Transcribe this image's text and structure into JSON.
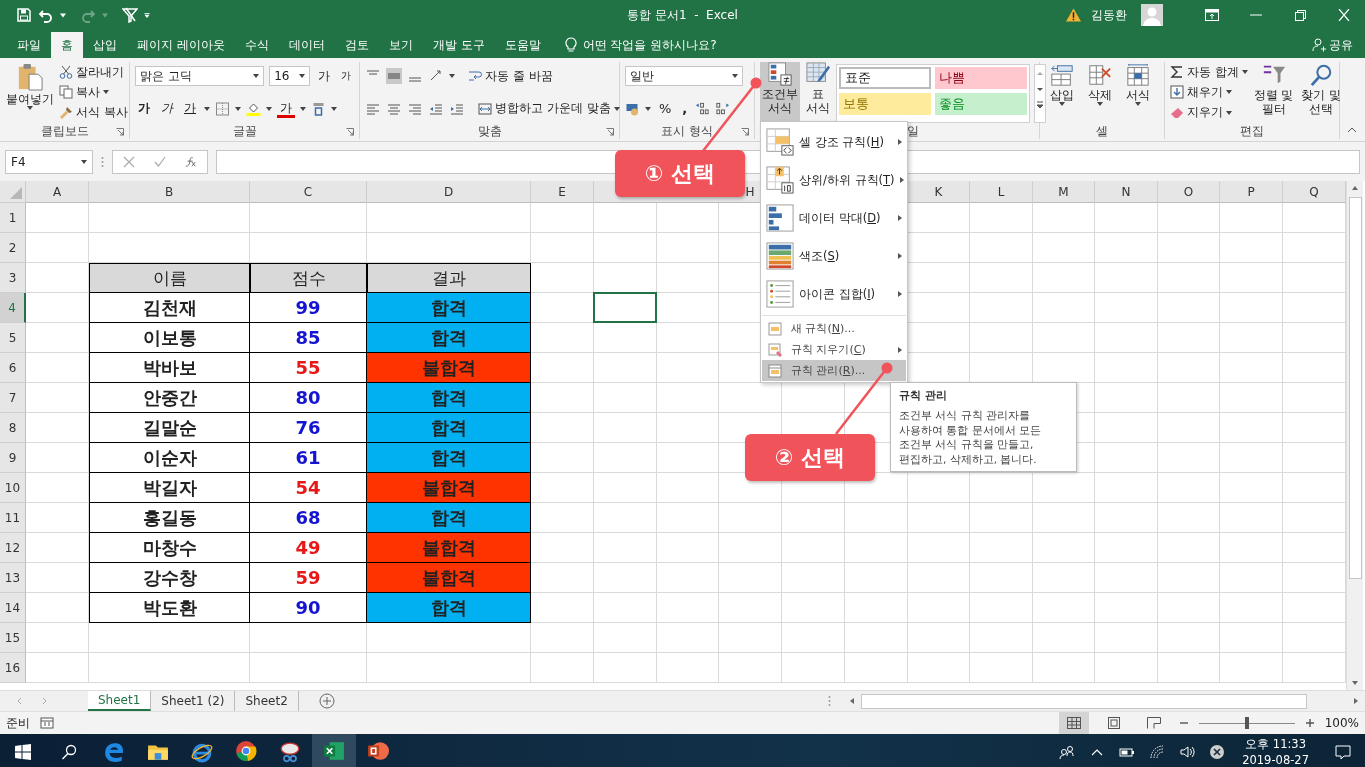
{
  "title_bar": {
    "title": "통합 문서1  -  Excel",
    "user": "김동환"
  },
  "tabs": [
    {
      "label": "파일",
      "selected": false
    },
    {
      "label": "홈",
      "selected": true
    },
    {
      "label": "삽입",
      "selected": false
    },
    {
      "label": "페이지 레이아웃",
      "selected": false
    },
    {
      "label": "수식",
      "selected": false
    },
    {
      "label": "데이터",
      "selected": false
    },
    {
      "label": "검토",
      "selected": false
    },
    {
      "label": "보기",
      "selected": false
    },
    {
      "label": "개발 도구",
      "selected": false
    },
    {
      "label": "도움말",
      "selected": false
    }
  ],
  "tell_me": "어떤 작업을 원하시나요?",
  "share": "공유",
  "ribbon": {
    "clipboard": {
      "label": "클립보드",
      "paste": "붙여넣기",
      "cut": "잘라내기",
      "copy": "복사",
      "format_painter": "서식 복사"
    },
    "font": {
      "label": "글꼴",
      "font_name": "맑은 고딕",
      "font_size": "16",
      "grow": "가",
      "shrink": "가",
      "bold": "가",
      "italic": "가",
      "underline": "가",
      "font_color": "가"
    },
    "alignment": {
      "label": "맞춤",
      "wrap_text": "자동 줄 바꿈",
      "merge_center": "병합하고 가운데 맞춤"
    },
    "number": {
      "label": "표시 형식",
      "format": "일반",
      "percent": "%",
      "comma": ","
    },
    "styles": {
      "label": "일",
      "conditional_formatting": {
        "lines": [
          "조건부",
          "서식"
        ],
        "expanded": true
      },
      "format_as_table": {
        "lines": [
          "표",
          "서식"
        ]
      },
      "gallery": [
        {
          "label": "표준",
          "color": "#ffffff"
        },
        {
          "label": "나쁨",
          "color": "#ffc7ce"
        },
        {
          "label": "보통",
          "color": "#ffeb9c"
        },
        {
          "label": "좋음",
          "color": "#c6efce"
        }
      ]
    },
    "cells": {
      "label": "셀",
      "insert": "삽입",
      "delete": "삭제",
      "format": "서식"
    },
    "editing": {
      "label": "편집",
      "autosum": "자동 합계",
      "fill": "채우기",
      "clear": "지우기",
      "sort_filter": [
        "정렬 및",
        "필터"
      ],
      "find_select": [
        "찾기 및",
        "선택"
      ]
    }
  },
  "formula_bar": {
    "name_box": "F4"
  },
  "sheet": {
    "columns": [
      {
        "label": "A",
        "selected": false
      },
      {
        "label": "B",
        "selected": false
      },
      {
        "label": "C",
        "selected": false
      },
      {
        "label": "D",
        "selected": false
      },
      {
        "label": "E",
        "selected": false
      },
      {
        "selected": true
      },
      null,
      {
        "label": "H",
        "selected": false
      },
      null,
      null,
      {
        "label": "K",
        "selected": false
      },
      {
        "label": "L",
        "selected": false
      },
      {
        "label": "M",
        "selected": false
      },
      {
        "label": "N",
        "selected": false
      },
      {
        "label": "O",
        "selected": false
      },
      {
        "label": "P",
        "selected": false
      },
      {
        "label": "Q",
        "selected": false
      }
    ],
    "rows": [
      {
        "label": "1",
        "selected": false
      },
      {
        "label": "2",
        "selected": false
      },
      {
        "label": "3",
        "selected": false
      },
      {
        "label": "4",
        "selected": true
      },
      {
        "label": "5",
        "selected": false
      },
      {
        "label": "6",
        "selected": false
      },
      {
        "label": "7",
        "selected": false
      },
      {
        "label": "8",
        "selected": false
      },
      {
        "label": "9",
        "selected": false
      },
      {
        "label": "10",
        "selected": false
      },
      {
        "label": "11",
        "selected": false
      },
      {
        "label": "12",
        "selected": false
      },
      {
        "label": "13",
        "selected": false
      },
      {
        "label": "14",
        "selected": false
      },
      {
        "label": "15",
        "selected": false
      },
      {
        "label": "16",
        "selected": false
      }
    ],
    "table": {
      "header": [
        "이름",
        "점수",
        "결과"
      ],
      "records": [
        {
          "name": "김천재",
          "score": "99",
          "result": "합격",
          "passed": true
        },
        {
          "name": "이보통",
          "score": "85",
          "result": "합격",
          "passed": true
        },
        {
          "name": "박바보",
          "score": "55",
          "result": "불합격",
          "passed": false
        },
        {
          "name": "안중간",
          "score": "80",
          "result": "합격",
          "passed": true
        },
        {
          "name": "길말순",
          "score": "76",
          "result": "합격",
          "passed": true
        },
        {
          "name": "이순자",
          "score": "61",
          "result": "합격",
          "passed": true
        },
        {
          "name": "박길자",
          "score": "54",
          "result": "불합격",
          "passed": false
        },
        {
          "name": "홍길동",
          "score": "68",
          "result": "합격",
          "passed": true
        },
        {
          "name": "마창수",
          "score": "49",
          "result": "불합격",
          "passed": false
        },
        {
          "name": "강수창",
          "score": "59",
          "result": "불합격",
          "passed": false
        },
        {
          "name": "박도환",
          "score": "90",
          "result": "합격",
          "passed": true
        }
      ]
    }
  },
  "menu": {
    "items": [
      {
        "kind": "highlight",
        "text": [
          "셀 강조 규칙(",
          "H",
          ")"
        ],
        "submenu": true,
        "selected": false
      },
      {
        "kind": "topbottom",
        "text": [
          "상위/하위 규칙(",
          "T",
          ")"
        ],
        "submenu": true,
        "selected": false
      },
      {
        "kind": "databars",
        "text": [
          "데이터 막대(",
          "D",
          ")"
        ],
        "submenu": true,
        "selected": false
      },
      {
        "kind": "colorscales",
        "text": [
          "색조(",
          "S",
          ")"
        ],
        "submenu": true,
        "selected": false
      },
      {
        "kind": "iconsets",
        "text": [
          "아이콘 집합(",
          "I",
          ")"
        ],
        "submenu": true,
        "selected": false
      },
      {
        "kind": "new",
        "text": [
          "새 규칙(",
          "N",
          ")..."
        ],
        "submenu": false,
        "selected": false
      },
      {
        "kind": "clear",
        "text": [
          "규칙 지우기(",
          "C",
          ")"
        ],
        "submenu": true,
        "selected": false
      },
      {
        "kind": "manage",
        "text": [
          "규칙 관리(",
          "R",
          ")..."
        ],
        "submenu": false,
        "selected": true
      }
    ]
  },
  "tooltip": {
    "title": "규칙 관리",
    "text": "조건부 서식 규칙 관리자를\n사용하여 통합 문서에서 모든\n조건부 서식 규칙을 만들고,\n편집하고, 삭제하고, 봅니다."
  },
  "callouts": [
    {
      "text": "① 선택"
    },
    {
      "text": "② 선택"
    }
  ],
  "sheet_tabs": [
    {
      "label": "Sheet1",
      "selected": true
    },
    {
      "label": "Sheet1 (2)",
      "selected": false
    },
    {
      "label": "Sheet2",
      "selected": false
    }
  ],
  "status_bar": {
    "status": "준비",
    "zoom": "100%",
    "zoom_slider": {
      "level": 0.5
    },
    "views": [
      {
        "kind": "normal",
        "selected": true
      },
      {
        "kind": "page_layout",
        "selected": false
      },
      {
        "kind": "page_break",
        "selected": false
      }
    ]
  },
  "taskbar": {
    "apps": [
      {
        "kind": "edge",
        "running": false,
        "active": false
      },
      {
        "kind": "explorer",
        "running": false,
        "active": false
      },
      {
        "kind": "ie",
        "running": false,
        "active": false
      },
      {
        "kind": "chrome",
        "running": true,
        "active": false
      },
      {
        "kind": "snipping",
        "running": false,
        "active": false
      },
      {
        "kind": "excel",
        "running": true,
        "active": true
      },
      {
        "kind": "powerpoint",
        "running": true,
        "active": false
      }
    ],
    "time": "오후 11:33",
    "date": "2019-08-27"
  }
}
